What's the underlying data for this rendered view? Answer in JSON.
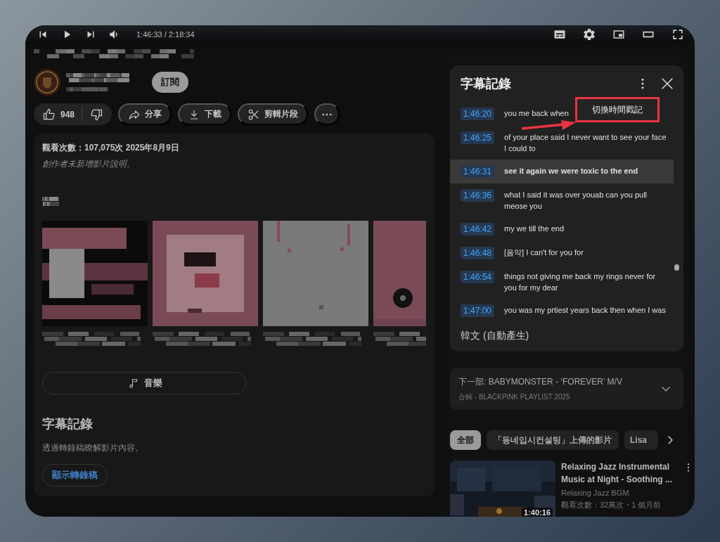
{
  "player": {
    "time": "1:46:33 / 2:18:34"
  },
  "video": {
    "subscribe": "訂閱",
    "likes": "948",
    "actions": [
      {
        "kind": "share",
        "label": "分享"
      },
      {
        "kind": "download",
        "label": "下載"
      },
      {
        "kind": "clip",
        "label": "剪輯片段"
      },
      {
        "kind": "more"
      }
    ]
  },
  "description": {
    "stats": "觀看次數：107,075次  2025年8月9日",
    "note": "創作者未新增影片說明。",
    "music_button": "音樂",
    "transcript_section": {
      "title": "字幕記錄",
      "text": "透過轉錄稿瞭解影片內容。",
      "button": "顯示轉錄稿"
    }
  },
  "transcript_panel": {
    "title": "字幕記錄",
    "menu_item": "切換時間戳記",
    "lines": [
      {
        "time": "1:46:20",
        "text": "you me back when",
        "selected": false
      },
      {
        "time": "1:46:25",
        "text": "of your place said I never want to see your face I could to",
        "selected": false
      },
      {
        "time": "1:46:31",
        "text": "see it again we were toxic to the end",
        "selected": true
      },
      {
        "time": "1:46:36",
        "text": "what I said it was over youab can you pull meose you",
        "selected": false
      },
      {
        "time": "1:46:42",
        "text": "my we till the end",
        "selected": false
      },
      {
        "time": "1:46:48",
        "text": "[음악] I can't for you for",
        "selected": false
      },
      {
        "time": "1:46:54",
        "text": "things not giving me back my rings never for you for my dear",
        "selected": false
      },
      {
        "time": "1:47:00",
        "text": "you was my prtiest years back then when I was",
        "selected": false
      }
    ],
    "footer": "韓文 (自動產生)"
  },
  "next_up": {
    "title": "下一部: BABYMONSTER - ‘FOREVER’ M/V",
    "subtitle": "合輯 - BLACKPINK PLAYLIST 2025"
  },
  "chips": [
    {
      "label": "全部",
      "selected": true
    },
    {
      "label": "「동네입시컨설팅」上傳的影片",
      "selected": false
    },
    {
      "label": "Lisa",
      "selected": false
    }
  ],
  "videos": [
    {
      "title": "Relaxing Jazz Instrumental Music at Night - Soothing ...",
      "channel": "Relaxing Jazz BGM",
      "meta": "觀看次數：32萬次・1 個月前",
      "duration": "1:40:16"
    }
  ]
}
